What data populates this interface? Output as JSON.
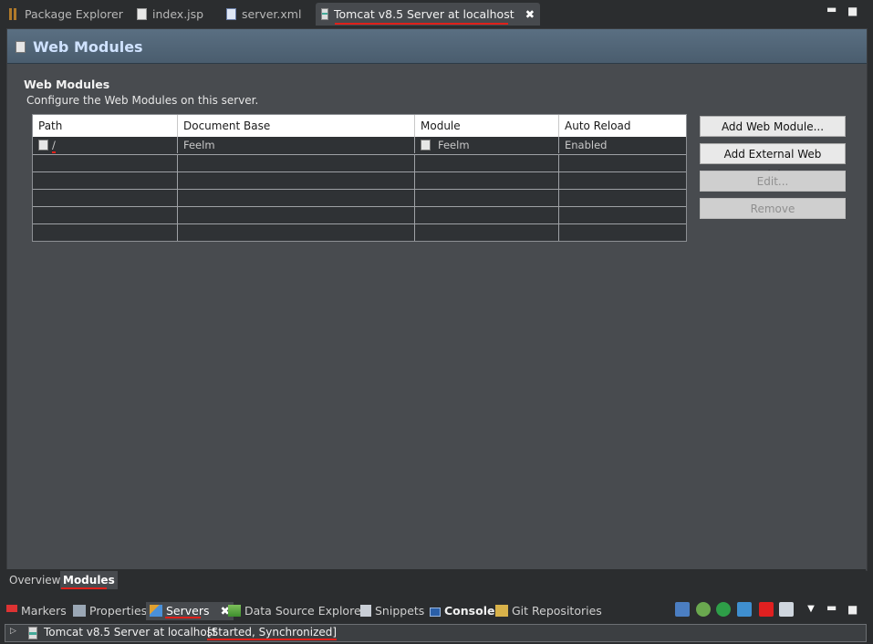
{
  "top_tabs": [
    {
      "label": "Package Explorer",
      "icon": "package-icon"
    },
    {
      "label": "index.jsp",
      "icon": "jsp-file-icon"
    },
    {
      "label": "server.xml",
      "icon": "xml-file-icon"
    },
    {
      "label": "Tomcat v8.5 Server at localhost",
      "icon": "tomcat-server-icon",
      "active": true
    }
  ],
  "window_controls": {
    "minimize": "▬",
    "maximize": "■"
  },
  "editor": {
    "header_title": "Web Modules",
    "section_title": "Web Modules",
    "section_desc": "Configure the Web Modules on this server.",
    "table": {
      "columns": [
        "Path",
        "Document Base",
        "Module",
        "Auto Reload"
      ],
      "rows": [
        {
          "path": "/",
          "document_base": "Feelm",
          "module": "Feelm",
          "auto_reload": "Enabled"
        }
      ]
    },
    "buttons": {
      "add_web_module": "Add Web Module...",
      "add_external": "Add External Web Module...",
      "edit": "Edit...",
      "remove": "Remove"
    },
    "page_tabs": [
      "Overview",
      "Modules"
    ]
  },
  "view_tabs": [
    {
      "label": "Markers",
      "icon": "markers-icon"
    },
    {
      "label": "Properties",
      "icon": "properties-icon"
    },
    {
      "label": "Servers",
      "icon": "servers-icon",
      "active": true
    },
    {
      "label": "Data Source Explorer",
      "icon": "data-source-icon"
    },
    {
      "label": "Snippets",
      "icon": "snippets-icon"
    },
    {
      "label": "Console",
      "icon": "console-icon"
    },
    {
      "label": "Git Repositories",
      "icon": "git-icon"
    }
  ],
  "server_entry": {
    "name": "Tomcat v8.5 Server at localhost",
    "status": "[Started, Synchronized]"
  },
  "colors": {
    "accent_underline": "#e0201a",
    "header_blue": "#5a6f82"
  }
}
